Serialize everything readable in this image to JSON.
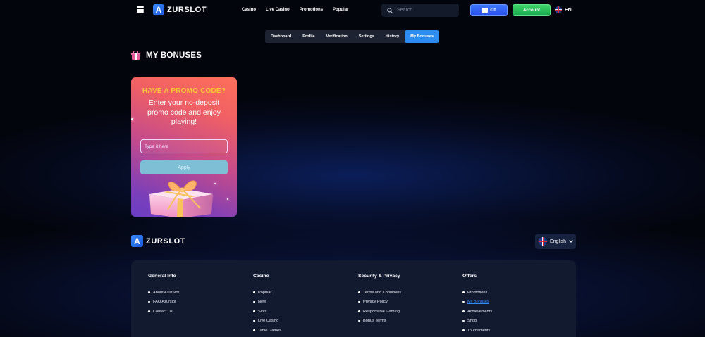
{
  "header": {
    "logo_letter": "A",
    "logo_text": "ZURSLOT",
    "nav": [
      "Casino",
      "Live Casino",
      "Promotions",
      "Popular"
    ],
    "search_placeholder": "Search",
    "balance": "€ 0",
    "account_label": "Account",
    "language_code": "EN"
  },
  "tabs": [
    {
      "label": "Dashboard",
      "active": false
    },
    {
      "label": "Profile",
      "active": false
    },
    {
      "label": "Verification",
      "active": false
    },
    {
      "label": "Settings",
      "active": false
    },
    {
      "label": "History",
      "active": false
    },
    {
      "label": "My Bonuses",
      "active": true
    }
  ],
  "page": {
    "title": "MY BONUSES"
  },
  "promo": {
    "heading": "HAVE A PROMO CODE?",
    "text": "Enter your no-deposit promo code and enjoy playing!",
    "input_placeholder": "Type it here",
    "apply_label": "Apply"
  },
  "footer": {
    "logo_letter": "A",
    "logo_text": "ZURSLOT",
    "language": "English",
    "columns": [
      {
        "title": "General Info",
        "items": [
          "About AzurSlot",
          "FAQ Azurslot",
          "Contact Us"
        ]
      },
      {
        "title": "Casino",
        "items": [
          "Popular",
          "New",
          "Slots",
          "Live Casino",
          "Table Games"
        ]
      },
      {
        "title": "Security & Privacy",
        "items": [
          "Terms and Conditions",
          "Privacy Policy",
          "Responsible Gaming",
          "Bonus Terms"
        ]
      },
      {
        "title": "Offers",
        "items": [
          "Promotions",
          "My Bonuses",
          "Achievements",
          "Shop",
          "Tournaments"
        ],
        "active_item": "My Bonuses"
      }
    ]
  },
  "colors": {
    "background": "#03050d",
    "accent_blue": "#2e8cf0",
    "account_green": "#19a84a",
    "promo_heading": "#ffc43a",
    "active_link": "#2f8cff"
  },
  "icons": [
    "menu-icon",
    "search-icon",
    "wallet-icon",
    "uk-flag-icon",
    "gift-icon",
    "chevron-down-icon"
  ]
}
